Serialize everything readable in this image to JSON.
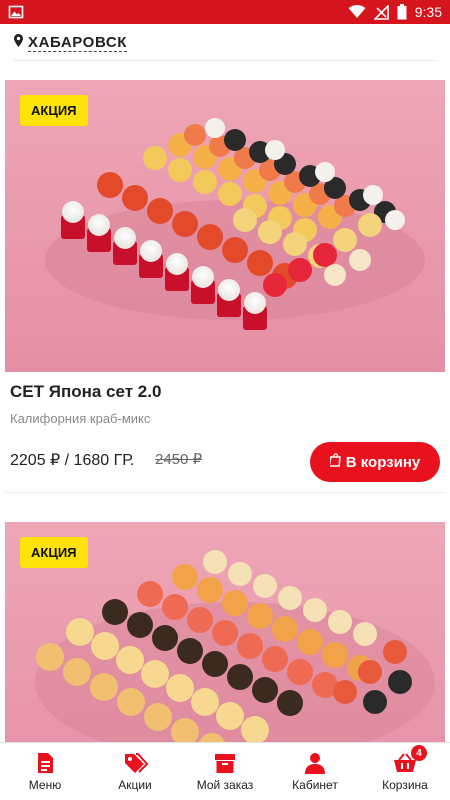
{
  "status_bar": {
    "time": "9:35"
  },
  "location": {
    "city": "ХАБАРОВСК"
  },
  "products": [
    {
      "badge": "АКЦИЯ",
      "title": "СЕТ Япона сет 2.0",
      "description": "Калифорния краб-микс",
      "price": "2205 ₽ / 1680 ГР.",
      "old_price": "2450 ₽",
      "cart_label": "В корзину"
    },
    {
      "badge": "АКЦИЯ"
    }
  ],
  "tabbar": {
    "items": [
      {
        "label": "Меню",
        "icon": "menu-doc-icon"
      },
      {
        "label": "Акции",
        "icon": "tags-icon"
      },
      {
        "label": "Мой заказ",
        "icon": "order-box-icon"
      },
      {
        "label": "Кабинет",
        "icon": "user-icon"
      },
      {
        "label": "Корзина",
        "icon": "basket-icon",
        "badge": "4"
      }
    ]
  },
  "colors": {
    "accent": "#e8121e",
    "status_bar": "#d5141e",
    "promo_badge": "#fde30a"
  }
}
